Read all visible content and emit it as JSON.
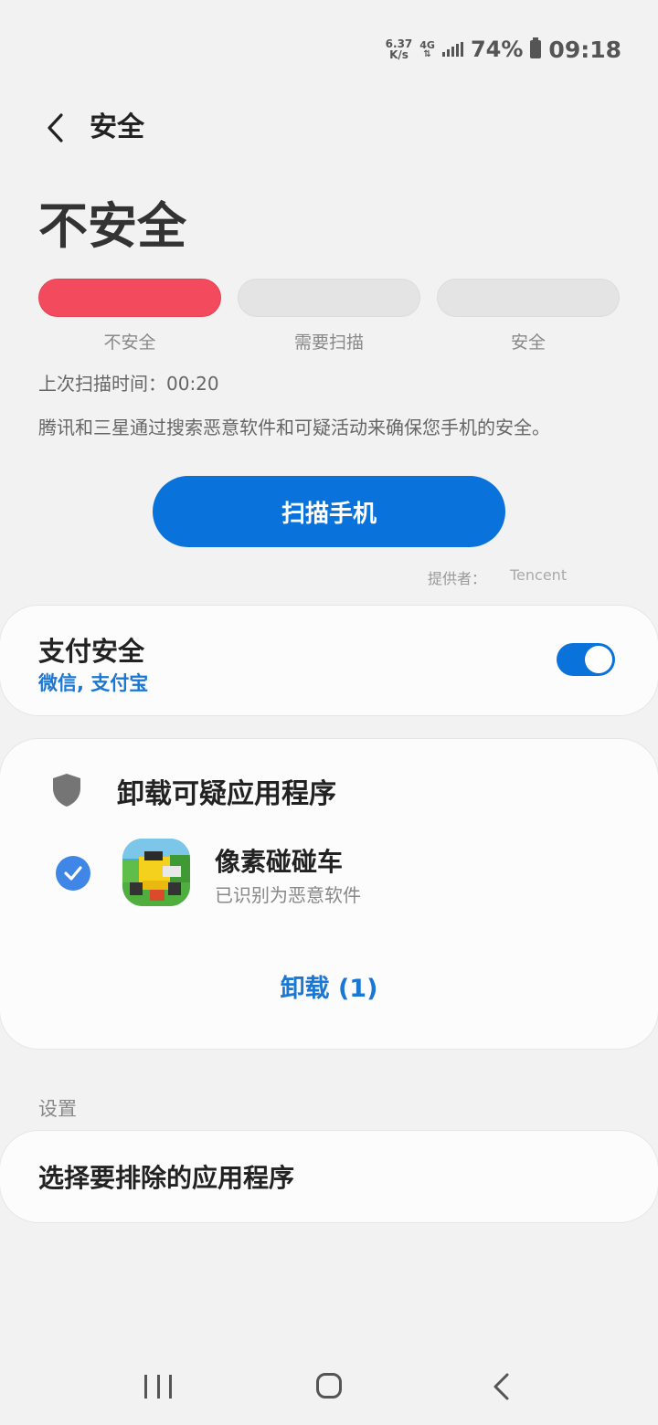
{
  "status_bar": {
    "net_speed_value": "6.37",
    "net_speed_unit": "K/s",
    "network_type": "4G",
    "battery": "74%",
    "time": "09:18"
  },
  "header": {
    "title": "安全"
  },
  "security": {
    "status": "不安全",
    "levels": [
      "不安全",
      "需要扫描",
      "安全"
    ],
    "active_level_index": 0,
    "last_scan": "上次扫描时间：00:20",
    "description": "腾讯和三星通过搜索恶意软件和可疑活动来确保您手机的安全。",
    "scan_button": "扫描手机",
    "provider_label": "提供者：",
    "provider_value": "Tencent"
  },
  "payment": {
    "title": "支付安全",
    "subtitle": "微信, 支付宝",
    "toggle_on": true
  },
  "suspicious": {
    "title": "卸载可疑应用程序",
    "apps": [
      {
        "name": "像素碰碰车",
        "status": "已识别为恶意软件",
        "checked": true
      }
    ],
    "uninstall_button": "卸载 (1)"
  },
  "settings": {
    "header": "设置",
    "exclude_apps": "选择要排除的应用程序"
  },
  "colors": {
    "accent": "#0a72db",
    "danger": "#f34a5d",
    "link": "#1a78d4"
  }
}
